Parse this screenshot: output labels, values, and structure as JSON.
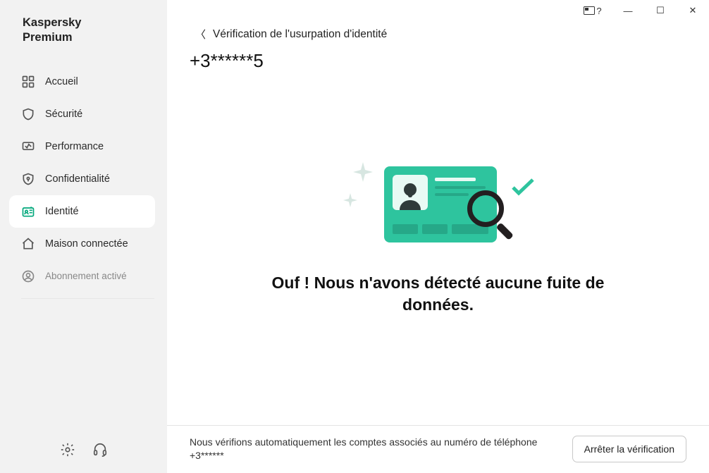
{
  "app": {
    "title_line1": "Kaspersky",
    "title_line2": "Premium"
  },
  "window": {
    "help_glyph": "?",
    "minimize": "—",
    "maximize": "☐",
    "close": "✕"
  },
  "sidebar": {
    "items": [
      {
        "label": "Accueil"
      },
      {
        "label": "Sécurité"
      },
      {
        "label": "Performance"
      },
      {
        "label": "Confidentialité"
      },
      {
        "label": "Identité"
      },
      {
        "label": "Maison connectée"
      }
    ],
    "subscription": "Abonnement activé"
  },
  "breadcrumb": {
    "label": "Vérification de l'usurpation d'identité"
  },
  "account": {
    "masked": "+3******5"
  },
  "hero": {
    "title": "Ouf ! Nous n'avons détecté aucune fuite de données."
  },
  "footer": {
    "text_line1": "Nous vérifions automatiquement les comptes associés au numéro de téléphone",
    "text_line2": "+3******",
    "button": "Arrêter la vérification"
  }
}
